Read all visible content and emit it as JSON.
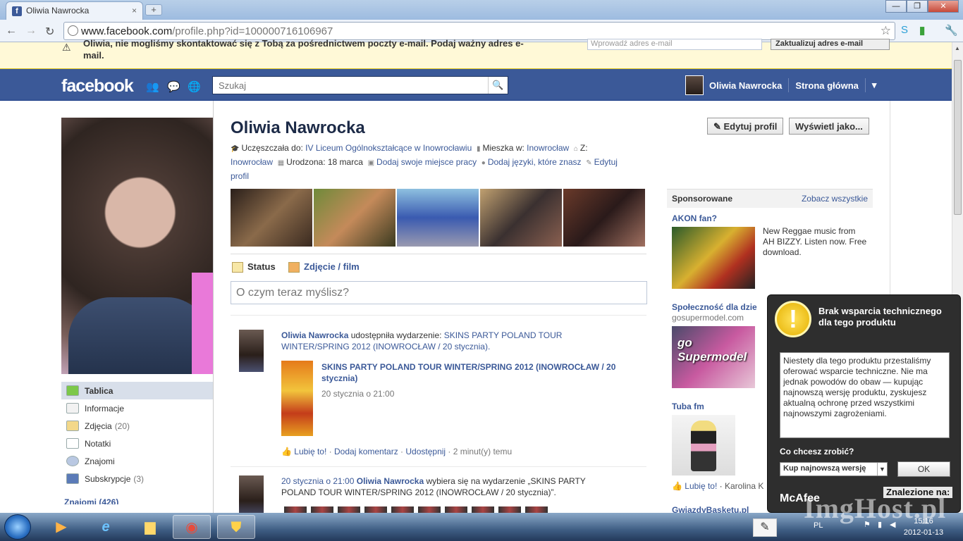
{
  "browser": {
    "tab_title": "Oliwia Nawrocka",
    "tab_close": "×",
    "new_tab": "+",
    "url_host": "www.facebook.com",
    "url_path": "/profile.php?id=100000716106967",
    "window_buttons": [
      "—",
      "❐",
      "✕"
    ]
  },
  "notice": {
    "text": "Oliwia, nie mogliśmy skontaktować się z Tobą za pośrednictwem poczty e-mail. Podaj ważny adres e-mail.",
    "input_placeholder": "Wprowadź adres e-mail",
    "button": "Zaktualizuj adres e-mail"
  },
  "header": {
    "logo": "facebook",
    "search_placeholder": "Szukaj",
    "user_name": "Oliwia Nawrocka",
    "home": "Strona główna",
    "menu_arrow": "▾"
  },
  "profile": {
    "name": "Oliwia Nawrocka",
    "edit_profile_btn": "Edytuj profil",
    "view_as_btn": "Wyświetl jako...",
    "school_label": "Uczęszczała do:",
    "school": "IV Liceum Ogólnokształcące w Inowrocławiu",
    "lives_label": "Mieszka w:",
    "lives": "Inowrocław",
    "from_label": "Z:",
    "from": "Inowrocław",
    "born_label": "Urodzona:",
    "born": "18 marca",
    "add_work": "Dodaj swoje miejsce pracy",
    "add_languages": "Dodaj języki, które znasz",
    "edit_profile_link": "Edytuj profil"
  },
  "leftnav": [
    {
      "label": "Tablica",
      "count": ""
    },
    {
      "label": "Informacje",
      "count": ""
    },
    {
      "label": "Zdjęcia",
      "count": "(20)"
    },
    {
      "label": "Notatki",
      "count": ""
    },
    {
      "label": "Znajomi",
      "count": ""
    },
    {
      "label": "Subskrypcje",
      "count": "(3)"
    }
  ],
  "leftnav_partial": "Znajomi (426)",
  "composer": {
    "tab_status": "Status",
    "tab_photo": "Zdjęcie / film",
    "placeholder": "O czym teraz myślisz?"
  },
  "feed": {
    "story1_name": "Oliwia Nawrocka",
    "story1_action": " udostępniła wydarzenie: ",
    "story1_link": "SKINS PARTY POLAND TOUR WINTER/SPRING 2012 (INOWROCŁAW / 20 stycznia).",
    "event_title": "SKINS PARTY POLAND TOUR WINTER/SPRING 2012 (INOWROCŁAW / 20 stycznia)",
    "event_date": "20 stycznia o 21:00",
    "like": "Lubię to!",
    "comment": "Dodaj komentarz",
    "share": "Udostępnij",
    "time": "2 minut(y) temu",
    "story2_date": "20 stycznia o 21:00",
    "story2_name": "Oliwia Nawrocka",
    "story2_action": " wybiera się na wydarzenie „SKINS PARTY POLAND TOUR WINTER/SPRING 2012 (INOWROCŁAW / 20 stycznia)”."
  },
  "ads": {
    "header": "Sponsorowane",
    "see_all": "Zobacz wszystkie",
    "ad1_title": "AKON fan?",
    "ad1_text": "New Reggae music from AH BIZZY. Listen now. Free download.",
    "ad2_title": "Społeczność dla dzie",
    "ad2_domain": "gosupermodel.com",
    "ad2_logo": "go Supermodel",
    "ad3_title": "Tuba fm",
    "ad3_like": "Lubię to!",
    "ad3_liker": "Karolina K",
    "ad4_title": "GwiazdyBasketu.pl"
  },
  "mcafee": {
    "title": "Brak wsparcia technicznego dla tego produktu",
    "message": "Niestety dla tego produktu przestaliśmy oferować wsparcie techniczne. Nie ma jednak powodów do obaw — kupując najnowszą wersję produktu, zyskujesz aktualną ochronę przed wszystkimi najnowszymi zagrożeniami.",
    "question": "Co chcesz zrobić?",
    "select_value": "Kup najnowszą wersję",
    "ok": "OK",
    "brand": "McAfee",
    "found_on": "Znalezione na:"
  },
  "taskbar": {
    "lang": "PL",
    "time": "15:16",
    "date": "2012-01-13"
  },
  "watermark": "ImgHost.pl"
}
